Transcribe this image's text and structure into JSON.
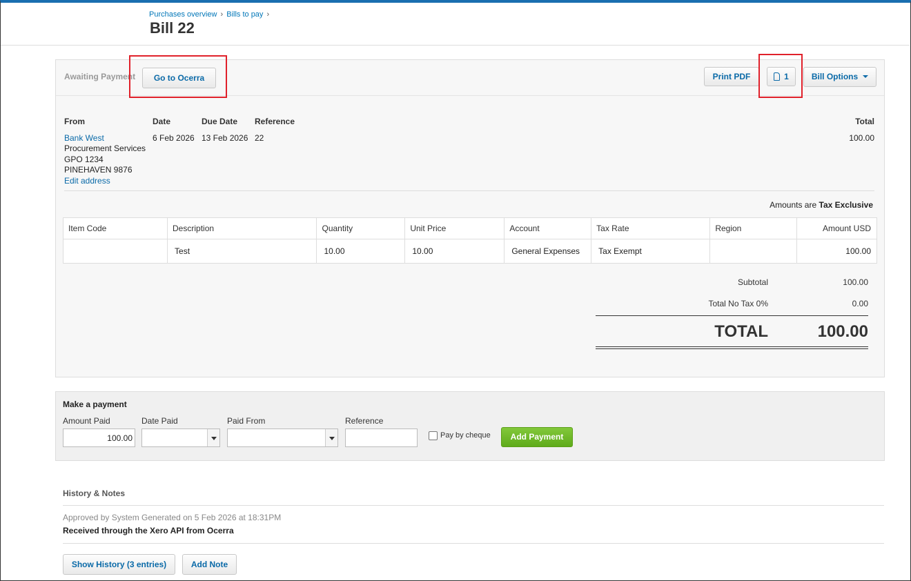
{
  "breadcrumb": {
    "item1": "Purchases overview",
    "sep1": "›",
    "item2": "Bills to pay",
    "sep2": "›"
  },
  "page": {
    "title": "Bill 22"
  },
  "bill": {
    "status": "Awaiting Payment",
    "go_ocerra_label": "Go to Ocerra",
    "print_pdf_label": "Print PDF",
    "attachments_count": "1",
    "attachment_icon": "paperclip-icon",
    "options_label": "Bill Options"
  },
  "header": {
    "from_label": "From",
    "date_label": "Date",
    "due_label": "Due Date",
    "ref_label": "Reference",
    "total_label": "Total",
    "from_name": "Bank West",
    "address1": "Procurement Services",
    "address2": "GPO 1234",
    "address3": "PINEHAVEN 9876",
    "edit_address": "Edit address",
    "date": "6 Feb 2026",
    "due_date": "13 Feb 2026",
    "reference": "22",
    "total": "100.00"
  },
  "amounts": {
    "prefix": "Amounts are",
    "mode": "Tax Exclusive"
  },
  "table": {
    "headers": [
      "Item Code",
      "Description",
      "Quantity",
      "Unit Price",
      "Account",
      "Tax Rate",
      "Region",
      "Amount USD"
    ],
    "rows": [
      {
        "item_code": "",
        "description": "Test",
        "quantity": "10.00",
        "unit_price": "10.00",
        "account": "General Expenses",
        "tax_rate": "Tax Exempt",
        "region": "",
        "amount": "100.00"
      }
    ]
  },
  "totals": {
    "subtotal_label": "Subtotal",
    "subtotal": "100.00",
    "tax_label": "Total No Tax 0%",
    "tax": "0.00",
    "total_label": "TOTAL",
    "total": "100.00"
  },
  "payment": {
    "title": "Make a payment",
    "amount_label": "Amount Paid",
    "amount_value": "100.00",
    "date_label": "Date Paid",
    "from_label": "Paid From",
    "ref_label": "Reference",
    "cheque_label": "Pay by cheque",
    "add_label": "Add Payment"
  },
  "history": {
    "title": "History & Notes",
    "approved": "Approved by System Generated on 5 Feb 2026 at 18:31PM",
    "note": "Received through the Xero API from Ocerra",
    "show_label": "Show History (3 entries)",
    "add_note_label": "Add Note"
  },
  "colors": {
    "accent": "#0a6aa8",
    "highlight": "#e0202a",
    "add_button": "#6ab626",
    "top_bar": "#1a6fb0"
  }
}
